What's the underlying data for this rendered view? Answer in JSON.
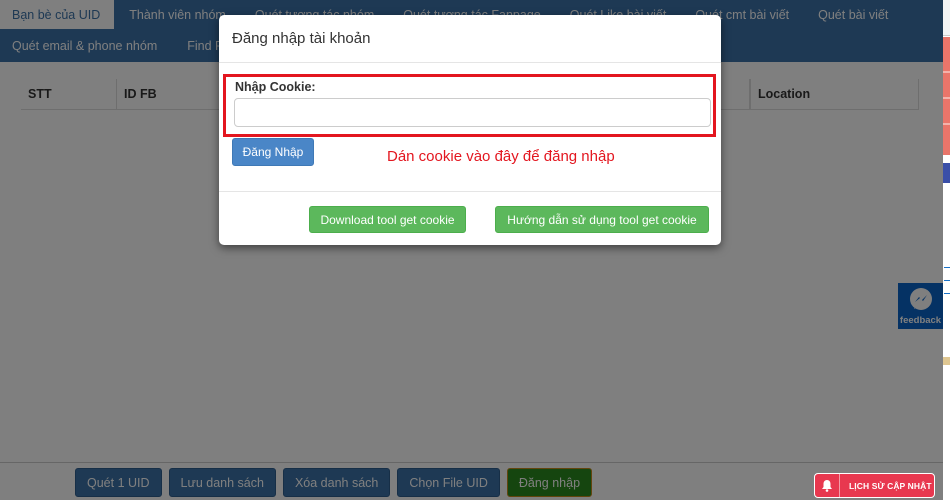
{
  "nav": {
    "row1": [
      {
        "label": "Bạn bè của UID",
        "active": true
      },
      {
        "label": "Thành viên nhóm"
      },
      {
        "label": "Quét tương tác nhóm"
      },
      {
        "label": "Quét tương tác Fanpage"
      },
      {
        "label": "Quét Like bài viết"
      },
      {
        "label": "Quét cmt bài viết"
      },
      {
        "label": "Quét bài viết"
      }
    ],
    "row2": [
      {
        "label": "Quét email & phone nhóm"
      },
      {
        "label": "Find Fb"
      }
    ]
  },
  "table": {
    "columns": [
      "STT",
      "ID FB",
      "Location"
    ]
  },
  "footer": {
    "buttons": [
      "Quét 1 UID",
      "Lưu danh sách",
      "Xóa danh sách",
      "Chọn File UID",
      "Đăng nhập"
    ]
  },
  "history_button": {
    "label": "LỊCH SỬ CẬP NHẬT",
    "icon": "bell-icon"
  },
  "feedback": {
    "label": "feedback",
    "icon": "messenger-icon"
  },
  "modal": {
    "title": "Đăng nhập tài khoản",
    "cookie_label": "Nhập Cookie:",
    "cookie_value": "",
    "cookie_placeholder": "",
    "login_button": "Đăng Nhập",
    "hint": "Dán cookie vào đây để đăng nhập",
    "download_button": "Download tool get cookie",
    "guide_button": "Hướng dẫn sử dụng tool get cookie"
  },
  "colors": {
    "nav_bg": "#3d73a8",
    "highlight_red": "#e3161f",
    "success_green": "#5cb85c",
    "primary_blue": "#4a86c7",
    "history_red": "#e8384f"
  }
}
